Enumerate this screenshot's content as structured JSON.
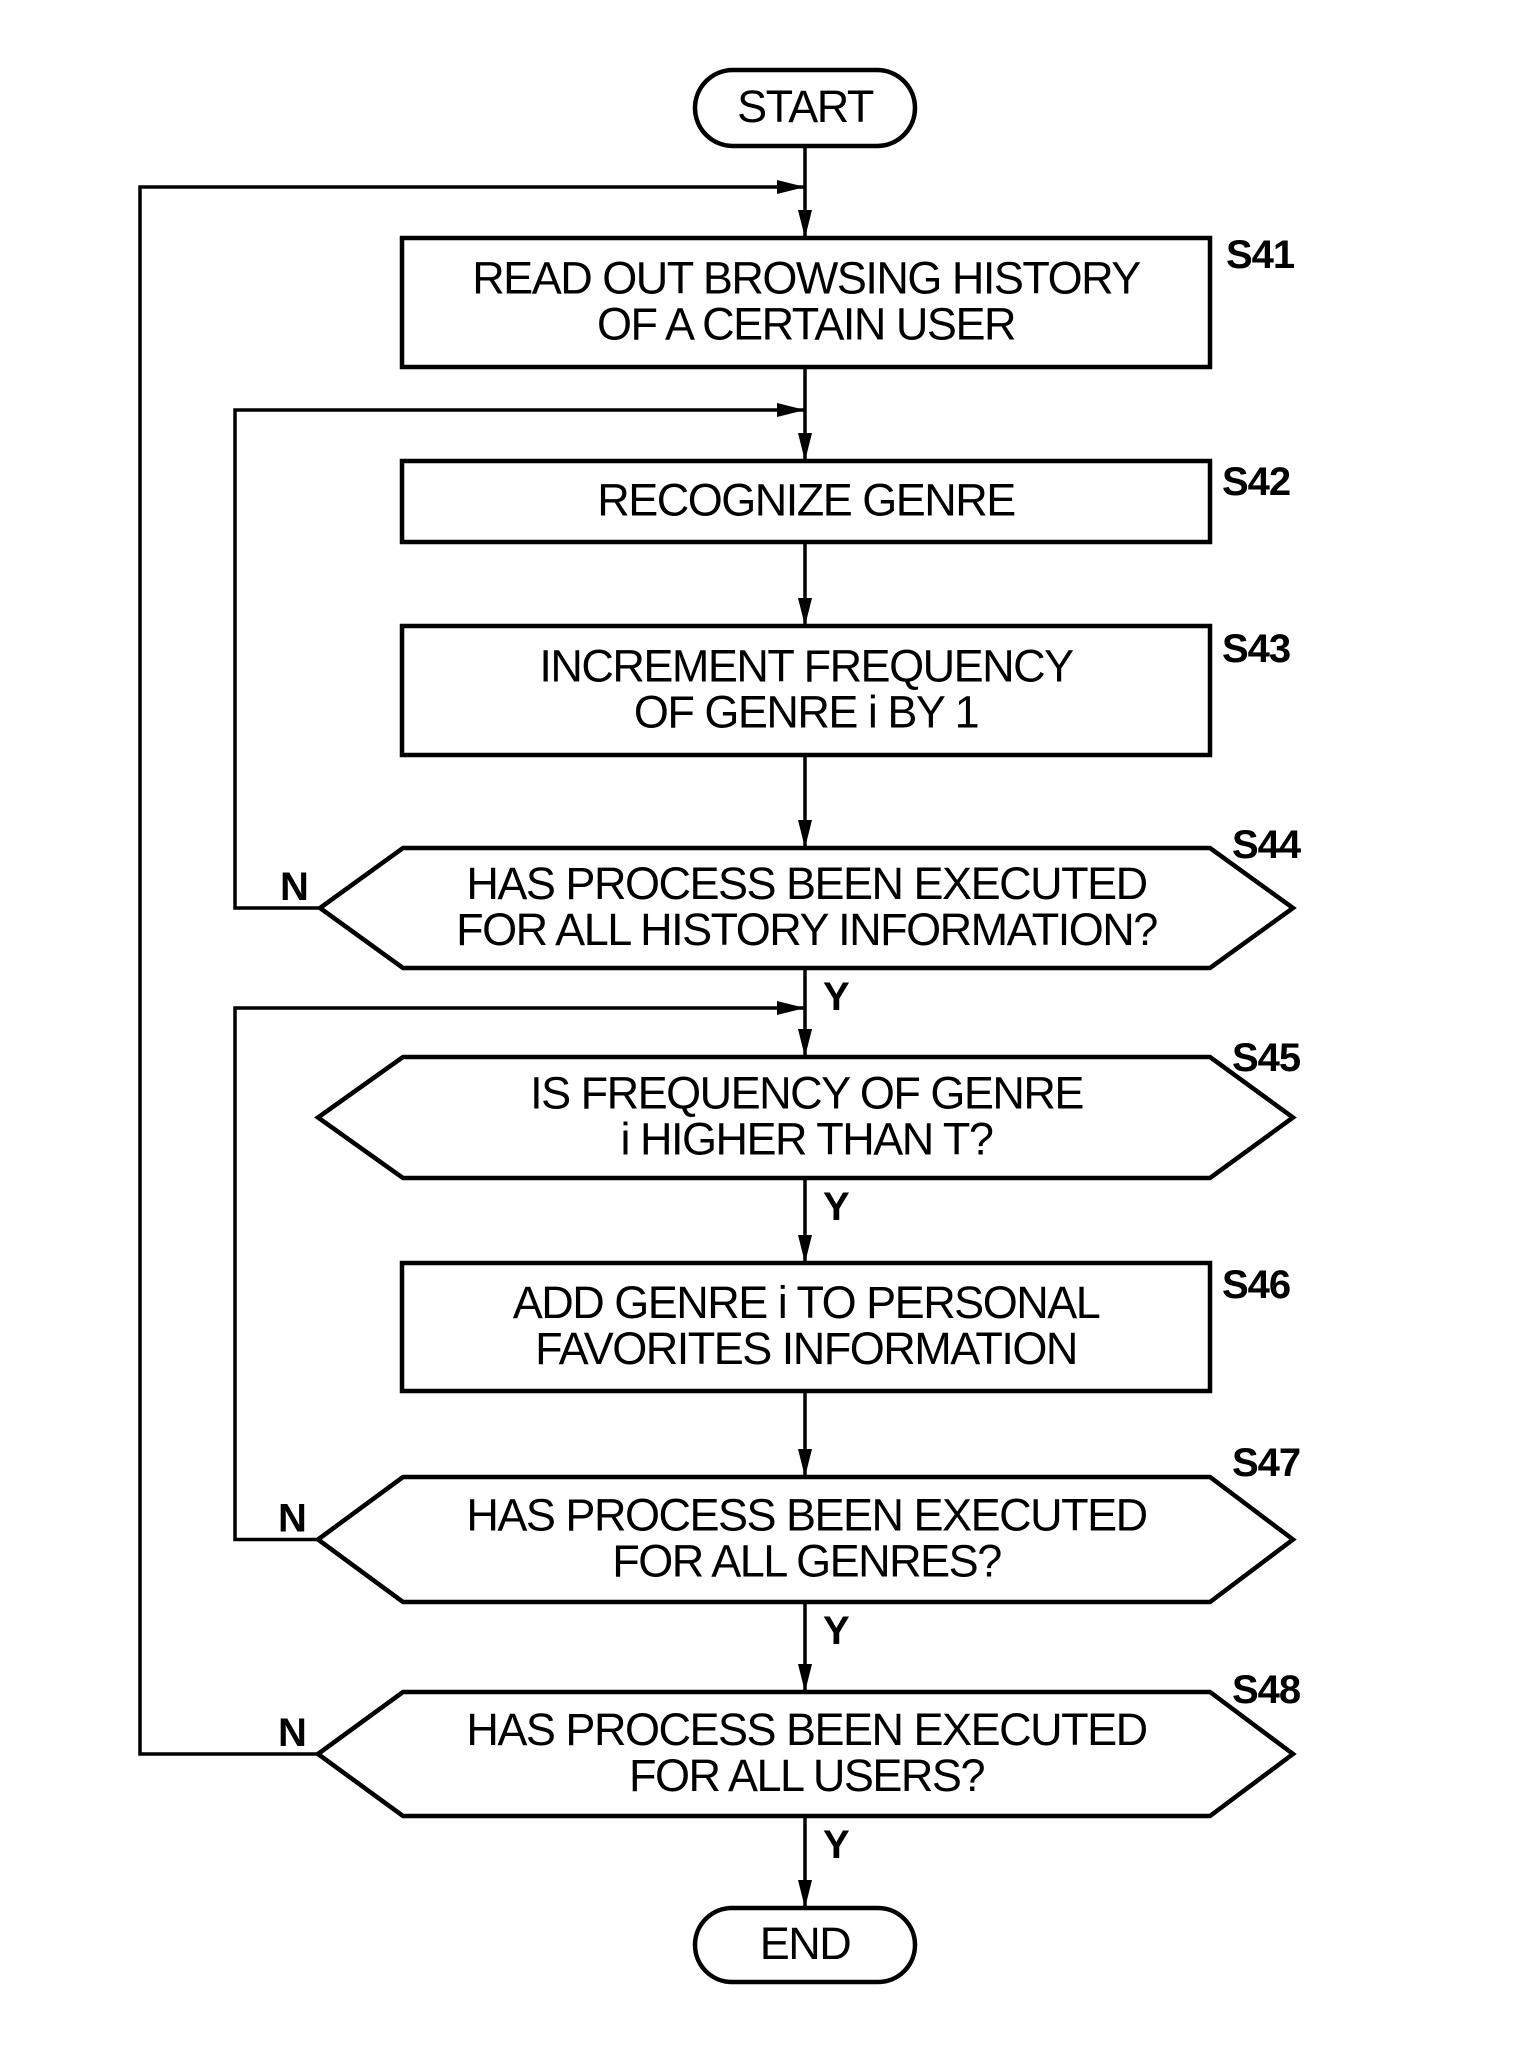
{
  "figure": {
    "type": "flowchart",
    "colors": {
      "stroke": "#000000",
      "background": "#ffffff"
    },
    "terminals": {
      "start": {
        "label": "START"
      },
      "end": {
        "label": "END"
      }
    },
    "steps": [
      {
        "id": "S41",
        "kind": "process",
        "lines": [
          "READ OUT BROWSING HISTORY",
          "OF A CERTAIN USER"
        ]
      },
      {
        "id": "S42",
        "kind": "process",
        "lines": [
          "RECOGNIZE GENRE"
        ]
      },
      {
        "id": "S43",
        "kind": "process",
        "lines": [
          "INCREMENT FREQUENCY",
          "OF GENRE i BY 1"
        ]
      },
      {
        "id": "S44",
        "kind": "decision",
        "lines": [
          "HAS PROCESS BEEN EXECUTED",
          "FOR ALL HISTORY INFORMATION?"
        ],
        "yes": "Y",
        "no": "N"
      },
      {
        "id": "S45",
        "kind": "decision",
        "lines": [
          "IS FREQUENCY OF GENRE",
          "i HIGHER THAN T?"
        ],
        "yes": "Y"
      },
      {
        "id": "S46",
        "kind": "process",
        "lines": [
          "ADD GENRE i TO PERSONAL",
          "FAVORITES INFORMATION"
        ]
      },
      {
        "id": "S47",
        "kind": "decision",
        "lines": [
          "HAS PROCESS BEEN EXECUTED",
          "FOR ALL GENRES?"
        ],
        "yes": "Y",
        "no": "N"
      },
      {
        "id": "S48",
        "kind": "decision",
        "lines": [
          "HAS PROCESS BEEN EXECUTED",
          "FOR ALL USERS?"
        ],
        "yes": "Y",
        "no": "N"
      }
    ],
    "edges": [
      {
        "from": "START",
        "to": "S41"
      },
      {
        "from": "S41",
        "to": "S42"
      },
      {
        "from": "S42",
        "to": "S43"
      },
      {
        "from": "S43",
        "to": "S44"
      },
      {
        "from": "S44",
        "to": "S42",
        "label": "N"
      },
      {
        "from": "S44",
        "to": "S45",
        "label": "Y"
      },
      {
        "from": "S45",
        "to": "S46",
        "label": "Y"
      },
      {
        "from": "S46",
        "to": "S47"
      },
      {
        "from": "S47",
        "to": "S45",
        "label": "N"
      },
      {
        "from": "S47",
        "to": "S48",
        "label": "Y"
      },
      {
        "from": "S48",
        "to": "S41",
        "label": "N"
      },
      {
        "from": "S48",
        "to": "END",
        "label": "Y"
      }
    ]
  }
}
